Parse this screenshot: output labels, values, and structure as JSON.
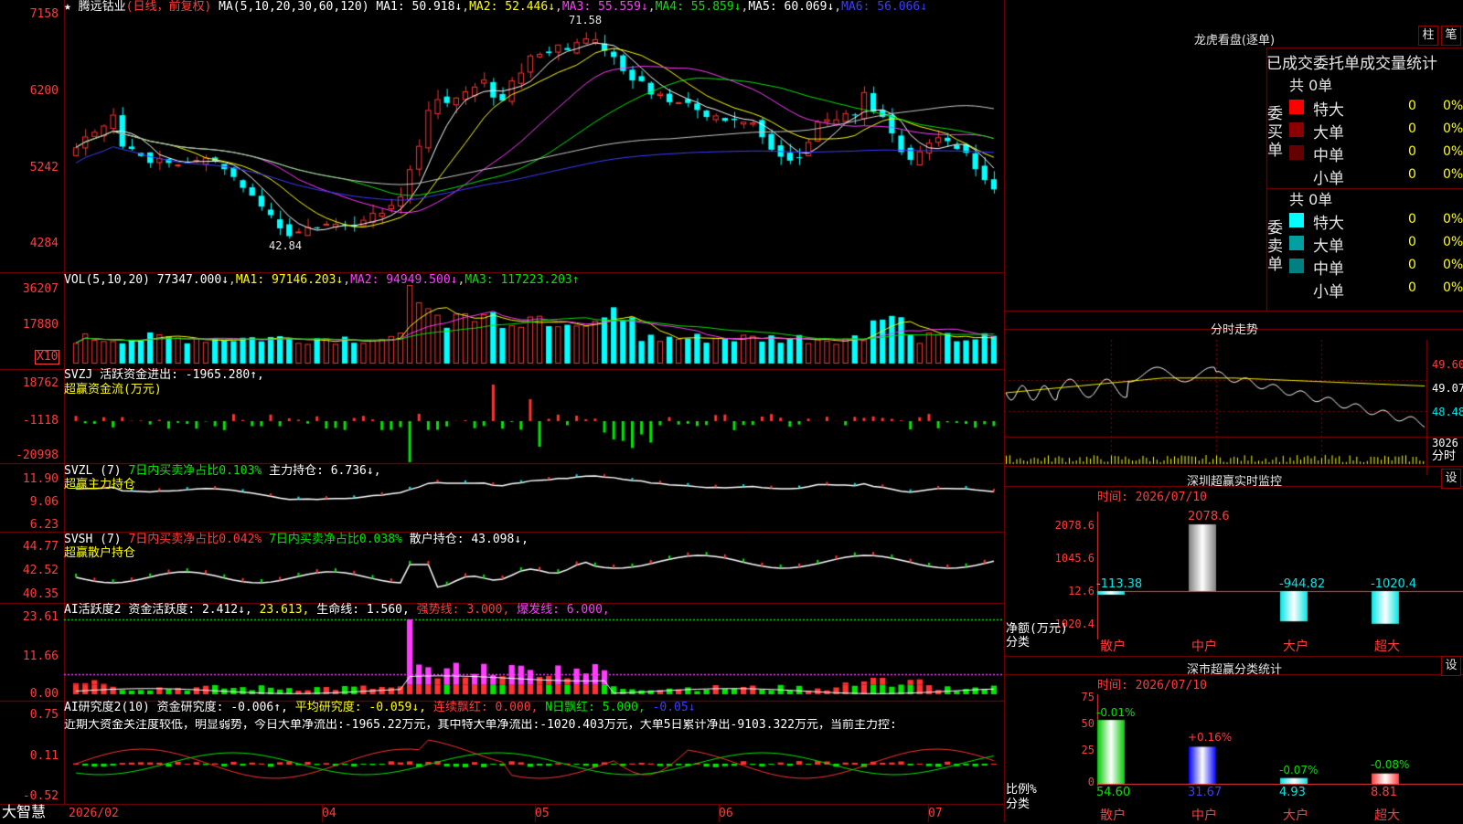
{
  "title_bar": {
    "star": "★",
    "stock_name": "腾远钴业",
    "period_label": "(日线，前复权)",
    "ma_spec": "MA(5,10,20,30,60,120)"
  },
  "kline_header": {
    "ma1": "MA1: 50.918↓",
    "ma2": "MA2: 52.446↓",
    "ma3": "MA3: 55.559↓",
    "ma4": "MA4: 55.859↓",
    "ma5": "MA5: 60.069↓",
    "ma6": "MA6: 56.066↓"
  },
  "kline_axis": [
    "7158",
    "6200",
    "5242",
    "4284"
  ],
  "kline_marks": {
    "high": "71.58",
    "low": "42.84"
  },
  "vol_header": {
    "spec": "VOL(5,10,20)",
    "val": "77347.000↓",
    "ma1": "MA1: 97146.203↓",
    "ma2": "MA2: 94949.500↓",
    "ma3": "MA3: 117223.203↑"
  },
  "vol_axis": [
    "36207",
    "17880"
  ],
  "vol_unit": "X10",
  "svzj_header": {
    "spec": "SVZJ",
    "text": "活跃资金进出: -1965.280↑,",
    "sub": "超赢资金流(万元)"
  },
  "svzj_axis": [
    "18762",
    "-1118",
    "-20998"
  ],
  "svzl_header": {
    "spec": "SVZL (7)",
    "text1": "7日内买卖净占比0.103%",
    "text2": "主力持仓: 6.736↓,",
    "sub": "超赢主力持仓"
  },
  "svzl_axis": [
    "11.90",
    "9.06",
    "6.23"
  ],
  "svsh_header": {
    "spec": "SVSH (7)",
    "text1": "7日内买卖净占比0.042%",
    "text2": "7日内买卖净占比0.038%",
    "text3": "散户持仓: 43.098↓,",
    "sub": "超赢散户持仓"
  },
  "svsh_axis": [
    "44.77",
    "42.52",
    "40.35"
  ],
  "ai1_header": {
    "spec": "AI活跃度2",
    "t1": "资金活跃度: 2.412↓,",
    "t2": "23.613,",
    "t3": "生命线: 1.560,",
    "t4": "强势线: 3.000,",
    "t5": "爆发线: 6.000,"
  },
  "ai1_axis": [
    "23.61",
    "11.66",
    "0.00"
  ],
  "ai2_header": {
    "spec": "AI研究度2(10)",
    "t1": "资金研究度: -0.006↑,",
    "t2": "平均研究度: -0.059↓,",
    "t3": "连续飘红: 0.000,",
    "t4": "N日飘红: 5.000,",
    "t5": "-0.05↓"
  },
  "ai2_note": "近期大资金关注度较低，明显弱势，今日大单净流出:-1965.22万元，其中特大单净流出:-1020.403万元，大单5日累计净出-9103.322万元，当前主力控:",
  "ai2_axis": [
    "0.75",
    "0.11",
    "-0.52"
  ],
  "date_axis": {
    "brand": "大智慧",
    "labels": [
      "2026/02",
      "04",
      "05",
      "06",
      "07"
    ]
  },
  "longhu": {
    "title": "龙虎看盘(逐单)",
    "btn_bar": "柱",
    "btn_stroke": "笔",
    "header": "已成交委托单成交量统计",
    "buy": {
      "side": "委买单",
      "count": "共 0单",
      "rows": [
        {
          "name": "特大",
          "val": "0",
          "pct": "0%",
          "color": "#ff0000"
        },
        {
          "name": "大单",
          "val": "0",
          "pct": "0%",
          "color": "#8c0000"
        },
        {
          "name": "中单",
          "val": "0",
          "pct": "0%",
          "color": "#640000"
        },
        {
          "name": "小单",
          "val": "0",
          "pct": "0%",
          "color": "#000000"
        }
      ]
    },
    "sell": {
      "side": "委卖单",
      "count": "共 0单",
      "rows": [
        {
          "name": "特大",
          "val": "0",
          "pct": "0%",
          "color": "#00ffff"
        },
        {
          "name": "大单",
          "val": "0",
          "pct": "0%",
          "color": "#00a0a0"
        },
        {
          "name": "中单",
          "val": "0",
          "pct": "0%",
          "color": "#008080"
        },
        {
          "name": "小单",
          "val": "0",
          "pct": "0%",
          "color": "#000000"
        }
      ]
    }
  },
  "fenshi": {
    "title": "分时走势",
    "axis": [
      "49.60",
      "49.07",
      "48.48",
      "3026"
    ],
    "unit": "分时"
  },
  "monitor": {
    "title": "深圳超赢实时监控",
    "set": "设",
    "time": "时间: 2026/07/10",
    "axis": [
      "2078.6",
      "1045.6",
      "12.6",
      "-1020.4"
    ],
    "ylabel": "净额(万元)",
    "xlabel": "分类",
    "cats": [
      "散户",
      "中户",
      "大户",
      "超大"
    ],
    "values": [
      "-113.38",
      "2078.6",
      "-944.82",
      "-1020.4"
    ]
  },
  "classify": {
    "title": "深市超赢分类统计",
    "set": "设",
    "time": "时间: 2026/07/10",
    "axis": [
      "75",
      "50",
      "25",
      "0"
    ],
    "ylabel": "比例%",
    "xlabel": "分类",
    "cats": [
      "散户",
      "中户",
      "大户",
      "超大"
    ],
    "changes": [
      "-0.01%",
      "+0.16%",
      "-0.07%",
      "-0.08%"
    ],
    "values": [
      "54.60",
      "31.67",
      "4.93",
      "8.81"
    ]
  },
  "chart_data": {
    "type": "candlestick",
    "title": "腾远钴业 (日线，前复权)",
    "ylim": [
      42.84,
      71.58
    ],
    "high": 71.58,
    "low": 42.84,
    "closes": [
      55.0,
      56.4,
      57.0,
      57.8,
      59.2,
      55.1,
      54.8,
      53.9,
      53.0,
      53.6,
      53.0,
      52.8,
      53.1,
      53.4,
      53.7,
      53.2,
      52.2,
      51.2,
      49.8,
      48.8,
      47.4,
      46.3,
      44.6,
      43.6,
      44.2,
      44.8,
      44.6,
      45.2,
      45.2,
      45.0,
      44.8,
      45.7,
      46.6,
      46.6,
      47.6,
      48.7,
      52.2,
      55.2,
      59.8,
      61.2,
      60.7,
      61.4,
      62.2,
      62.8,
      63.7,
      61.4,
      61.0,
      63.6,
      64.6,
      66.8,
      67.0,
      67.1,
      68.2,
      67.5,
      68.5,
      69.0,
      68.9,
      67.4,
      66.6,
      64.8,
      63.6,
      63.5,
      61.8,
      61.9,
      60.8,
      60.8,
      60.7,
      59.8,
      58.9,
      59.1,
      58.4,
      58.5,
      58.3,
      58.2,
      56.3,
      54.7,
      53.8,
      53.3,
      53.7,
      55.7,
      58.3,
      58.6,
      58.6,
      59.4,
      59.1,
      62.1,
      59.6,
      58.9,
      56.8,
      54.4,
      53.4,
      54.5,
      55.6,
      56.3,
      55.8,
      54.8,
      54.3,
      52.2,
      50.8,
      49.6
    ]
  }
}
